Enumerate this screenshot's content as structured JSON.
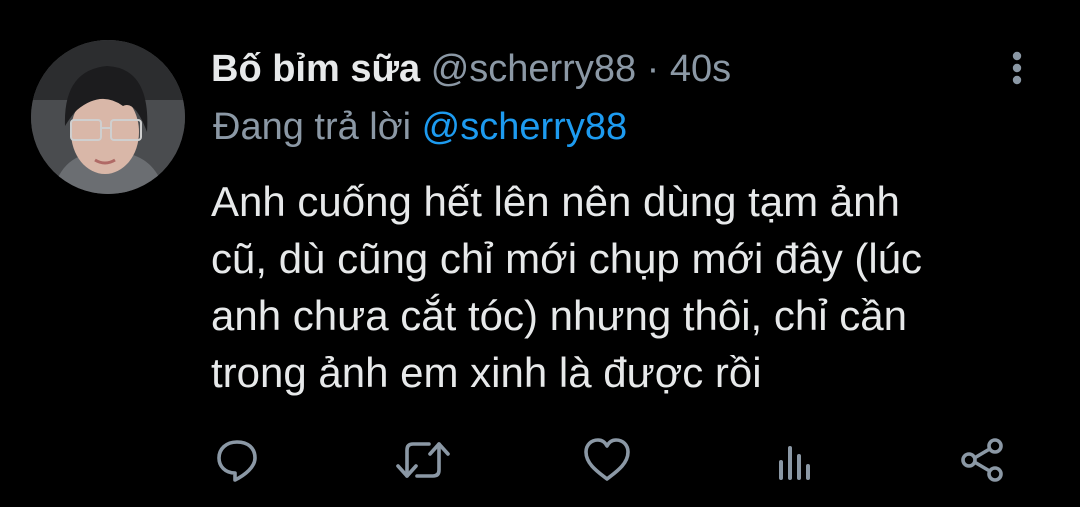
{
  "tweet": {
    "display_name": "Bố bỉm sữa",
    "handle": "@scherry88",
    "separator": "·",
    "time": "40s",
    "replying_to_label": "Đang trả lời",
    "replying_to_handle": "@scherry88",
    "text": "Anh cuống hết lên nên dùng tạm ảnh\ncũ, dù cũng chỉ mới chụp mới đây (lúc\nanh chưa cắt tóc) nhưng thôi, chỉ cần\ntrong ảnh em xinh là được rồi"
  },
  "actions": [
    {
      "icon": "reply-icon"
    },
    {
      "icon": "retweet-icon"
    },
    {
      "icon": "like-icon"
    },
    {
      "icon": "analytics-icon"
    },
    {
      "icon": "share-icon"
    }
  ],
  "colors": {
    "background": "#000000",
    "primary_text": "#e7e9ea",
    "secondary_text": "#8b98a5",
    "accent": "#1d9bf0"
  }
}
